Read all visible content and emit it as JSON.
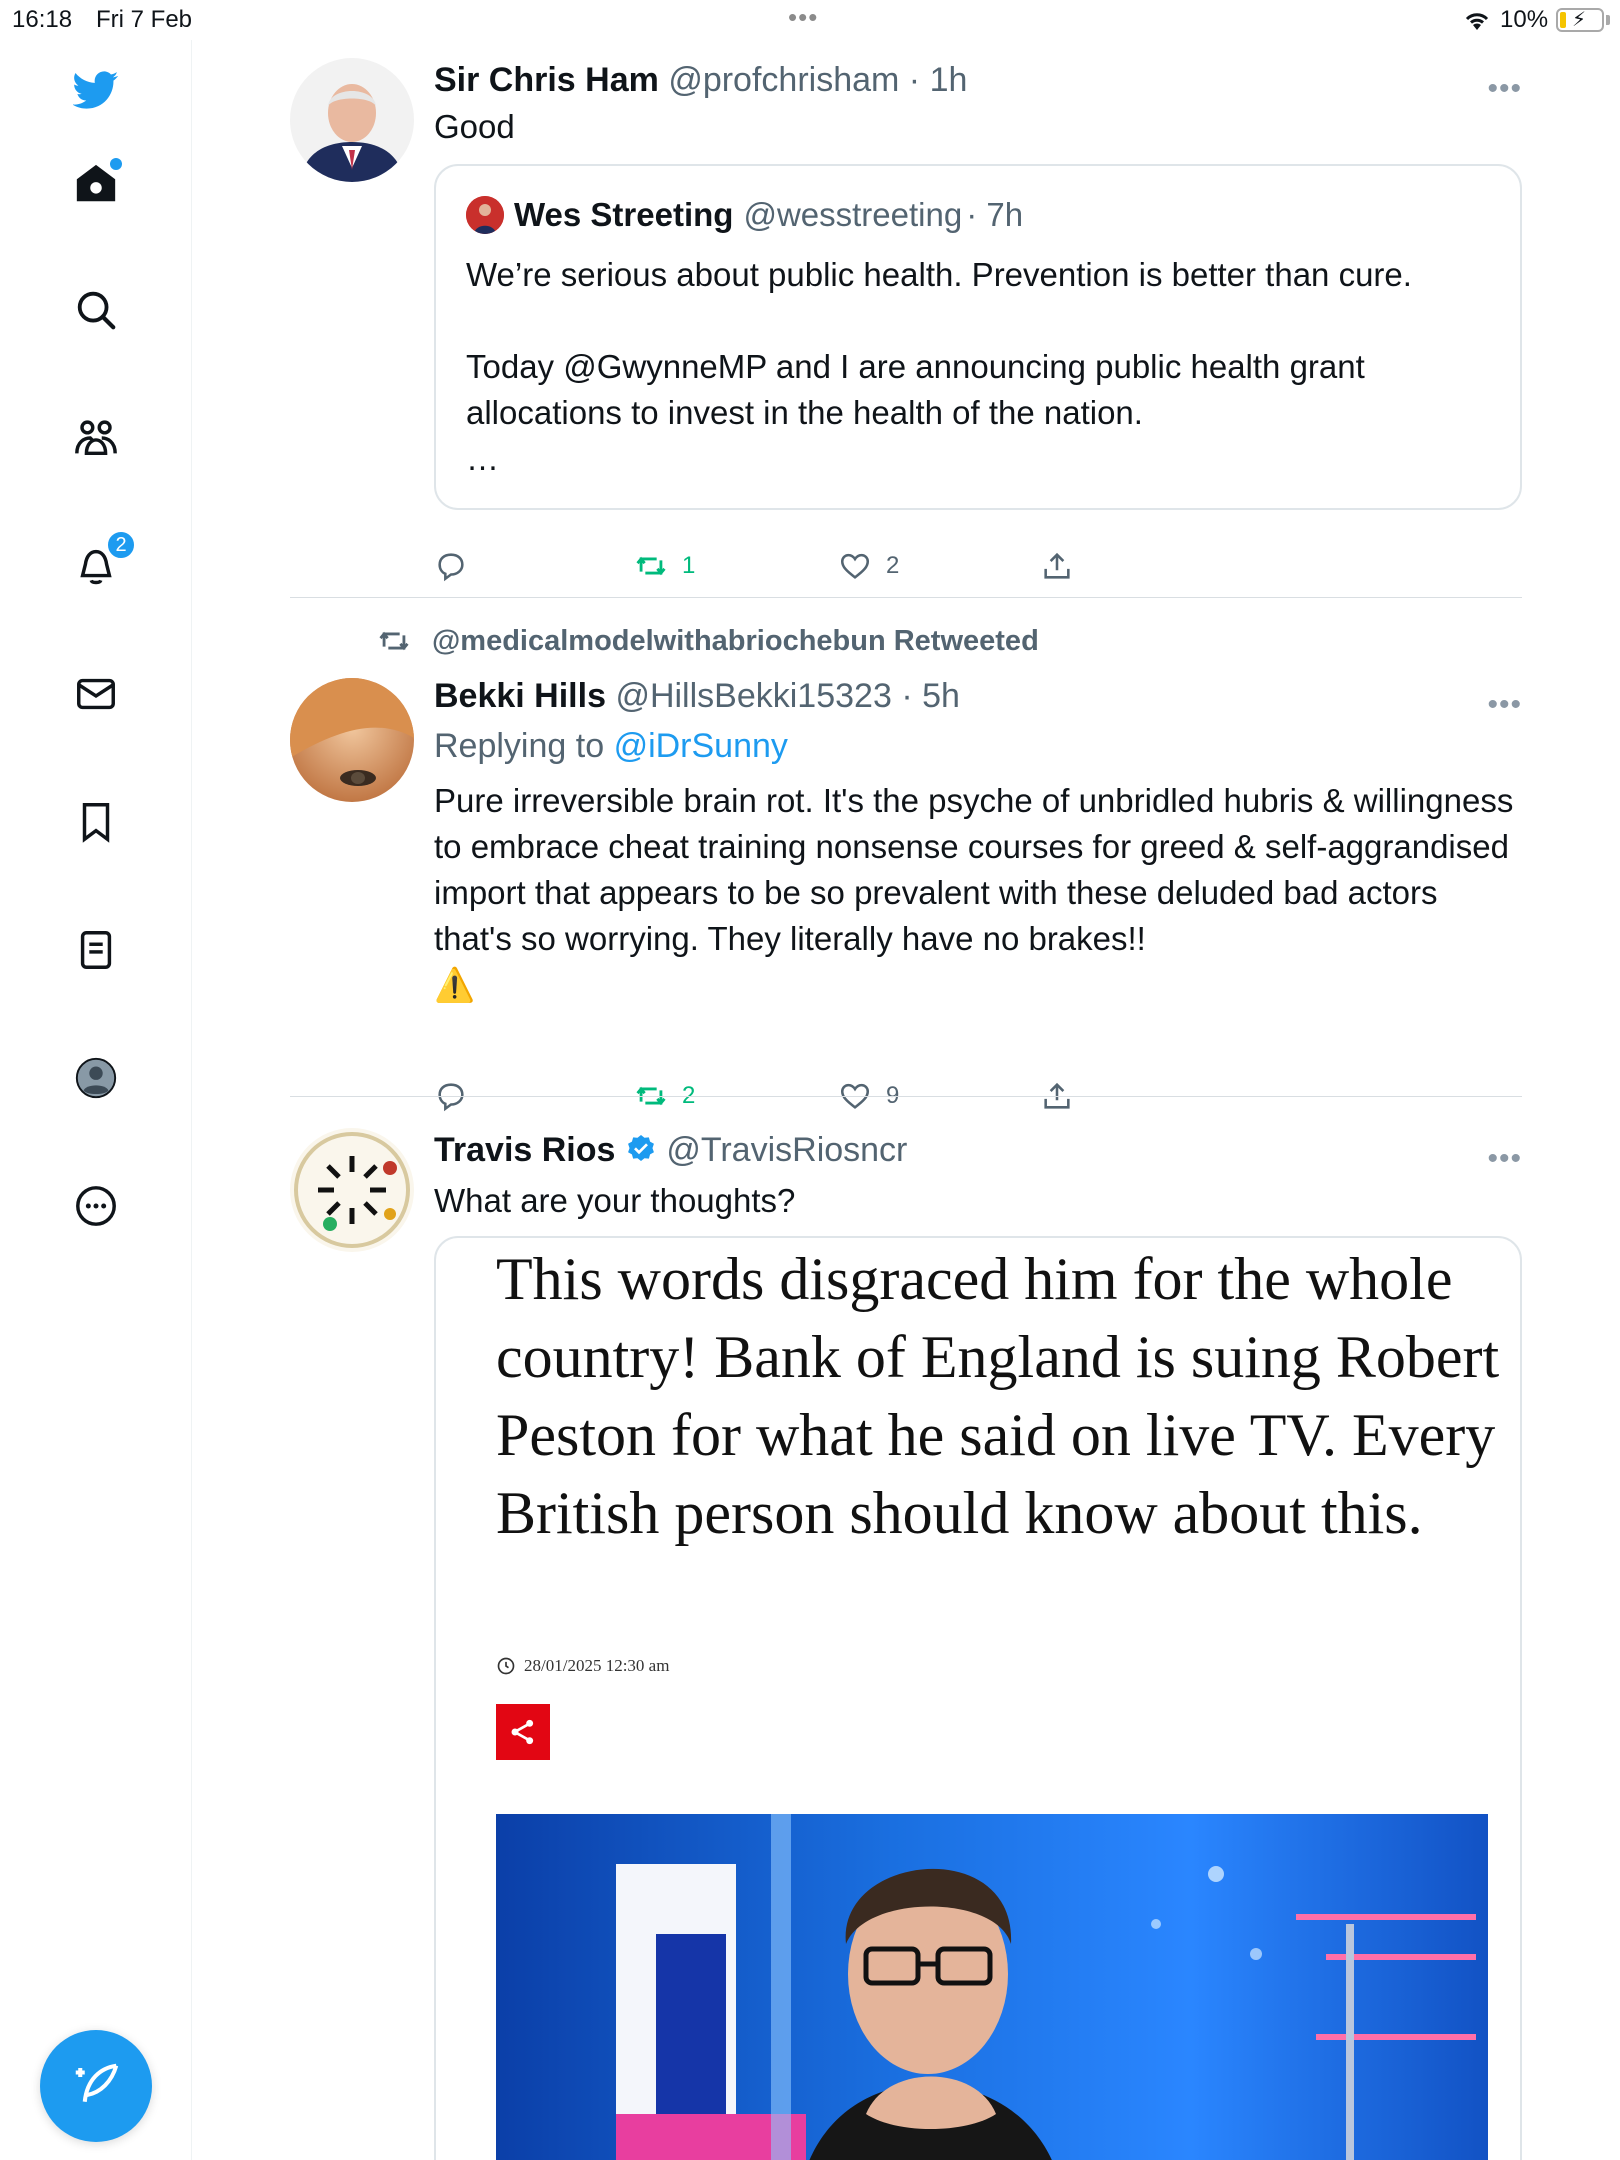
{
  "status_bar": {
    "time": "16:18",
    "date": "Fri 7 Feb",
    "battery": "10%"
  },
  "sidebar": {
    "notifications_badge": "2",
    "items": [
      "home",
      "search",
      "communities",
      "notifications",
      "messages",
      "bookmarks",
      "lists",
      "profile",
      "more"
    ]
  },
  "tweets": [
    {
      "name": "Sir Chris Ham",
      "handle": "@profchrisham",
      "time": "· 1h",
      "text": "Good",
      "quote": {
        "name": "Wes Streeting",
        "handle": "@wesstreeting",
        "time": "· 7h",
        "line1": "We’re serious about public health. Prevention is better than cure.",
        "line2": "Today @GwynneMP and I are announcing public health grant allocations to invest in the health of the nation.",
        "ellipsis": "…"
      },
      "replies": "",
      "retweets": "1",
      "likes": "2"
    },
    {
      "retweeted_by": "@medicalmodelwithabriochebun Retweeted",
      "name": "Bekki Hills",
      "handle": "@HillsBekki15323",
      "time": "· 5h",
      "replying_label": "Replying to",
      "replying_to": "@iDrSunny",
      "text": "Pure irreversible brain rot. It's the psyche of unbridled hubris & willingness to embrace cheat training nonsense courses for greed & self-aggrandised import that appears to be so prevalent with these deluded bad actors that's so worrying. They literally have no brakes!!",
      "emoji": "⚠️",
      "replies": "",
      "retweets": "2",
      "likes": "9"
    },
    {
      "name": "Travis Rios",
      "handle": "@TravisRiosncr",
      "verified": true,
      "text": "What are your thoughts?",
      "media": {
        "headline": "This words disgraced him for the whole country! Bank of England is suing Robert Peston for what he said on live TV. Every British person should know about this.",
        "timestamp": "28/01/2025 12:30 am"
      }
    }
  ],
  "colors": {
    "accent": "#1d9bf0",
    "retweet": "#00ba7c",
    "muted": "#536471"
  }
}
